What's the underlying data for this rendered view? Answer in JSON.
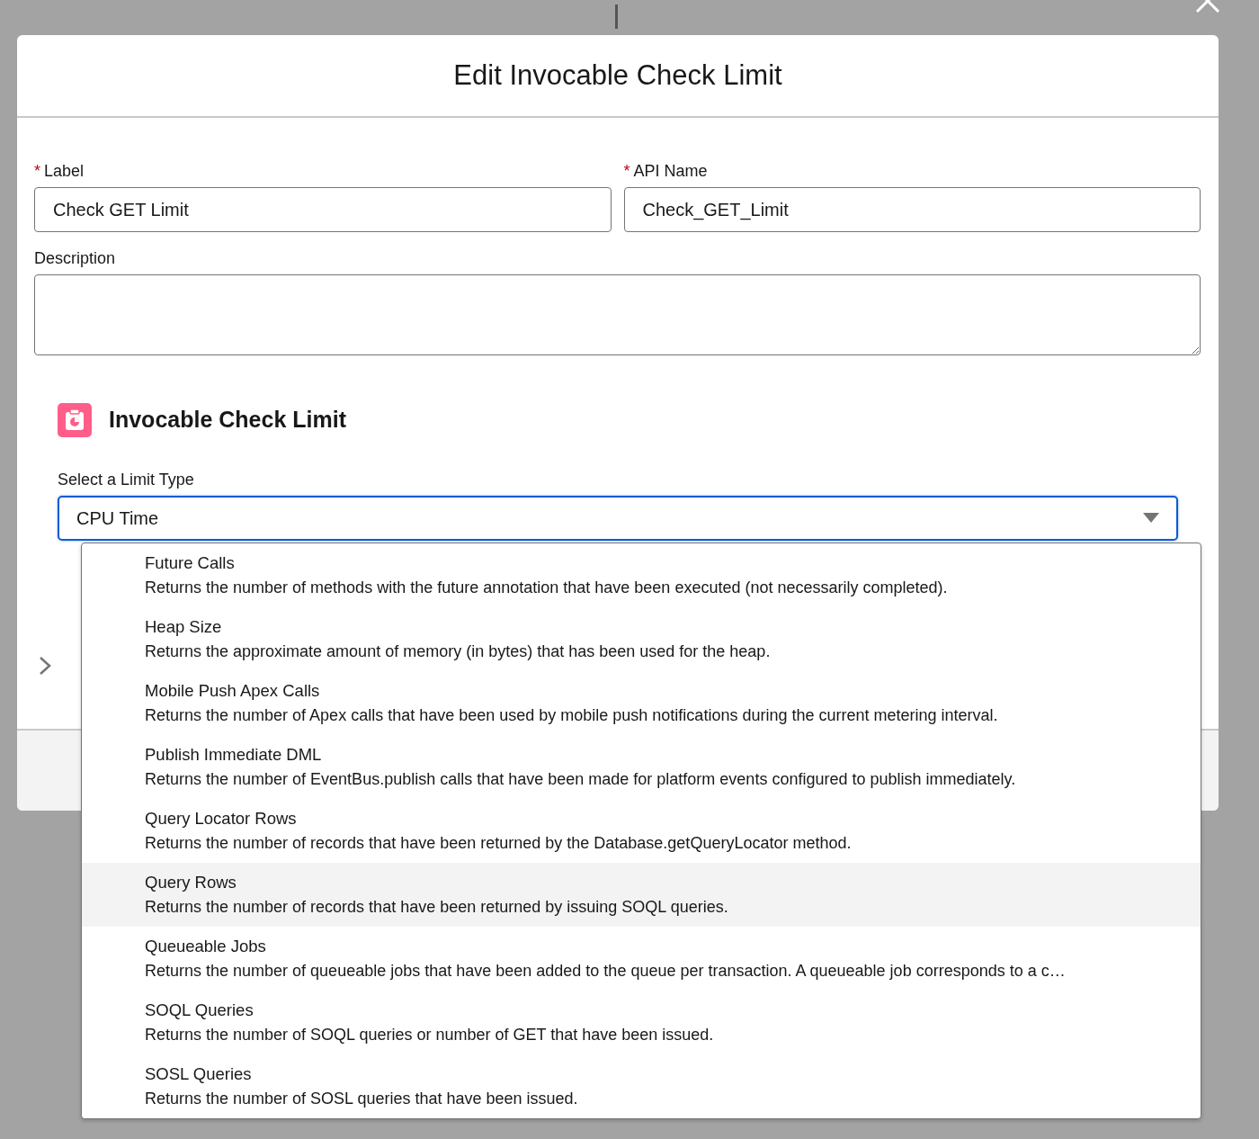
{
  "modal": {
    "title": "Edit Invocable Check Limit"
  },
  "fields": [
    {
      "required_mark": "*",
      "label": "Label",
      "value": "Check GET Limit"
    },
    {
      "required_mark": "*",
      "label": "API Name",
      "value": "Check_GET_Limit"
    }
  ],
  "description": {
    "label": "Description"
  },
  "section": {
    "title": "Invocable Check Limit"
  },
  "limit_type": {
    "label": "Select a Limit Type",
    "value": "CPU Time",
    "expanded": true,
    "options": [
      {
        "name": "Future Calls",
        "description": "Returns the number of methods with the future annotation that have been executed (not necessarily completed).",
        "selected": false
      },
      {
        "name": "Heap Size",
        "description": "Returns the approximate amount of memory (in bytes) that has been used for the heap.",
        "selected": false
      },
      {
        "name": "Mobile Push Apex Calls",
        "description": "Returns the number of Apex calls that have been used by mobile push notifications during the current metering interval.",
        "selected": false
      },
      {
        "name": "Publish Immediate DML",
        "description": "Returns the number of EventBus.publish calls that have been made for platform events configured to publish immediately.",
        "selected": false
      },
      {
        "name": "Query Locator Rows",
        "description": "Returns the number of records that have been returned by the Database.getQueryLocator method.",
        "selected": false
      },
      {
        "name": "Query Rows",
        "description": "Returns the number of records that have been returned by issuing SOQL queries.",
        "selected": true
      },
      {
        "name": "Queueable Jobs",
        "description": "Returns the number of queueable jobs that have been added to the queue per transaction. A queueable job corresponds to a c…",
        "selected": false
      },
      {
        "name": "SOQL Queries",
        "description": "Returns the number of SOQL queries or number of GET that have been issued.",
        "selected": false
      },
      {
        "name": "SOSL Queries",
        "description": "Returns the number of SOSL queries that have been issued.",
        "selected": false
      }
    ]
  }
}
